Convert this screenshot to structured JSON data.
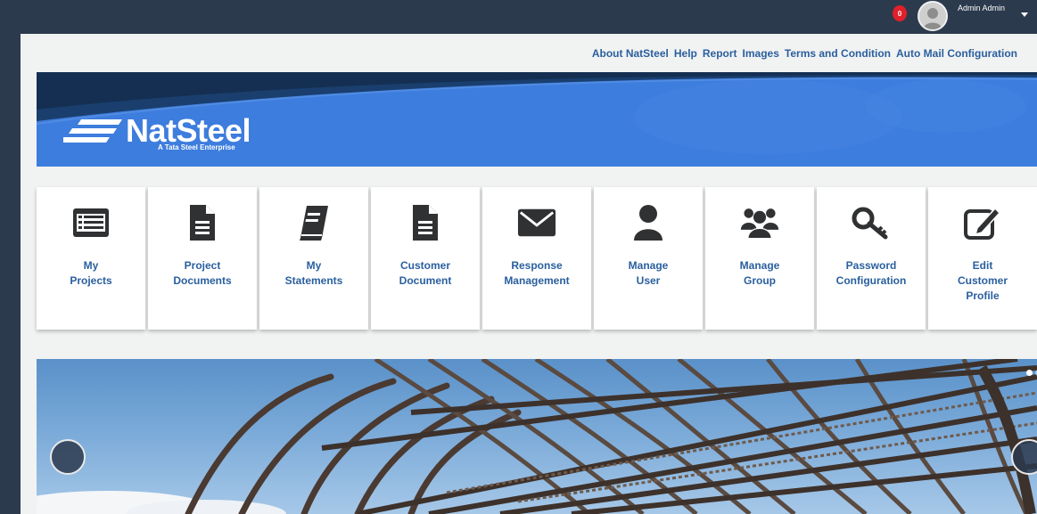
{
  "header": {
    "notification_count": "0",
    "username": "Admin Admin"
  },
  "top_links": [
    "About NatSteel",
    "Help",
    "Report",
    "Images",
    "Terms and Condition",
    "Auto Mail Configuration"
  ],
  "banner": {
    "logo_text": "NatSteel",
    "logo_tagline": "A Tata Steel Enterprise"
  },
  "tiles": [
    {
      "label": "My\nProjects",
      "icon": "list-icon"
    },
    {
      "label": "Project\nDocuments",
      "icon": "document-icon"
    },
    {
      "label": "My\nStatements",
      "icon": "book-icon"
    },
    {
      "label": "Customer\nDocument",
      "icon": "document-icon"
    },
    {
      "label": "Response\nManagement",
      "icon": "envelope-icon"
    },
    {
      "label": "Manage\nUser",
      "icon": "user-icon"
    },
    {
      "label": "Manage\nGroup",
      "icon": "group-icon"
    },
    {
      "label": "Password\nConfiguration",
      "icon": "key-icon"
    },
    {
      "label": "Edit\nCustomer\nProfile",
      "icon": "edit-icon"
    }
  ],
  "colors": {
    "header_bg": "#2c3a4d",
    "link_blue": "#2a5f9e",
    "banner_blue": "#3d7ddd",
    "badge_red": "#e0202a",
    "icon_dark": "#2f3133"
  }
}
